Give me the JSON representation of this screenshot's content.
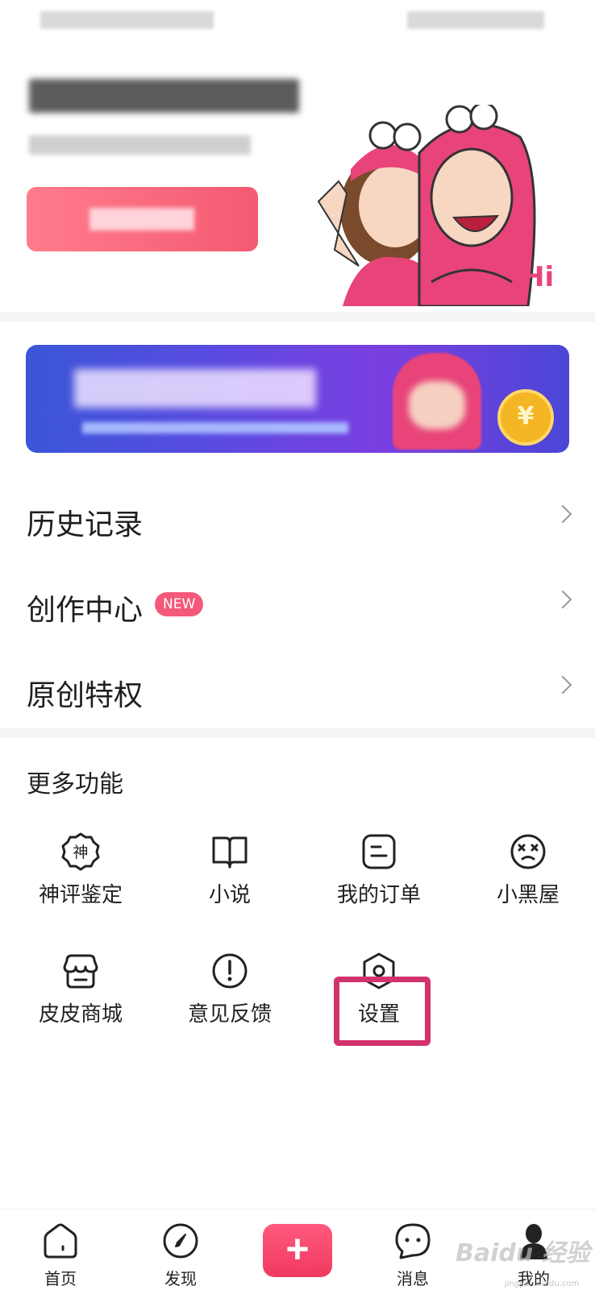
{
  "menu": {
    "history_label": "历史记录",
    "creator_label": "创作中心",
    "creator_badge": "NEW",
    "original_label": "原创特权"
  },
  "more": {
    "title": "更多功能",
    "items": [
      {
        "label": "神评鉴定",
        "icon": "shen-badge-icon"
      },
      {
        "label": "小说",
        "icon": "book-icon"
      },
      {
        "label": "我的订单",
        "icon": "order-icon"
      },
      {
        "label": "小黑屋",
        "icon": "dizzy-face-icon"
      },
      {
        "label": "皮皮商城",
        "icon": "store-icon"
      },
      {
        "label": "意见反馈",
        "icon": "exclamation-icon"
      },
      {
        "label": "设置",
        "icon": "settings-hex-icon"
      }
    ],
    "shen_glyph": "神"
  },
  "banner": {
    "coin_symbol": "¥"
  },
  "hero": {
    "hi_text": "Hi"
  },
  "tabs": [
    {
      "label": "首页",
      "icon": "home-icon"
    },
    {
      "label": "发现",
      "icon": "compass-icon"
    },
    {
      "label": "+",
      "icon": "plus-icon"
    },
    {
      "label": "消息",
      "icon": "chat-icon"
    },
    {
      "label": "我的",
      "icon": "profile-icon"
    }
  ],
  "watermark": {
    "text": "Baidu 经验",
    "sub": "jingyan.baidu.com"
  },
  "colors": {
    "accent": "#f4587a",
    "highlight": "#d2336d",
    "banner": "#5a4be0"
  }
}
